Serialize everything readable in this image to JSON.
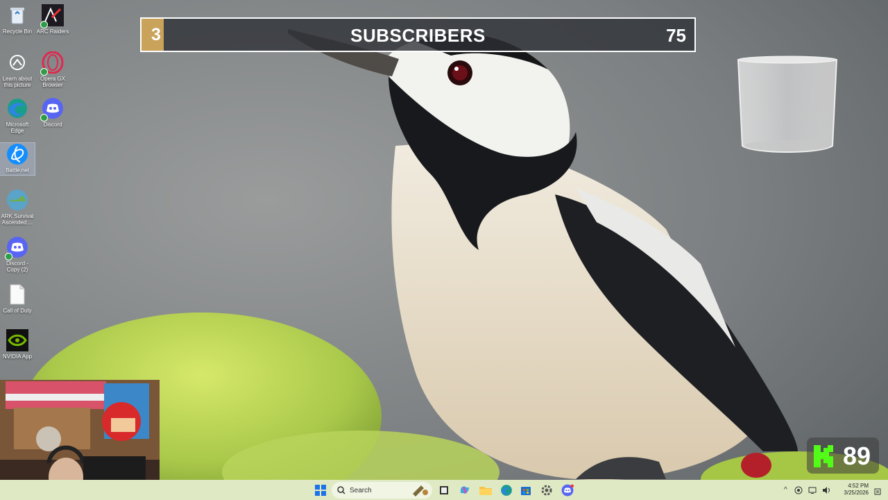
{
  "desktop": {
    "icons": [
      {
        "label": "Recycle Bin",
        "icon": "recycle-bin-icon"
      },
      {
        "label": "ARC Raiders",
        "icon": "arc-raiders-icon"
      },
      {
        "label": "Learn about this picture",
        "icon": "learn-about-picture-icon"
      },
      {
        "label": "Opera GX Browser",
        "icon": "opera-gx-icon"
      },
      {
        "label": "Microsoft Edge",
        "icon": "edge-icon"
      },
      {
        "label": "Discord",
        "icon": "discord-icon"
      },
      {
        "label": "Battle.net",
        "icon": "battlenet-icon"
      },
      {
        "label": "ARK Survival Ascended ...",
        "icon": "ark-icon"
      },
      {
        "label": "Discord - Copy (2)",
        "icon": "discord-icon"
      },
      {
        "label": "Call of Duty",
        "icon": "file-icon"
      },
      {
        "label": "NVIDIA App",
        "icon": "nvidia-icon"
      }
    ]
  },
  "subscriber_goal": {
    "count": "3",
    "label": "SUBSCRIBERS",
    "goal": "75",
    "progress_fraction": 0.04,
    "fill_color": "#c9a35a"
  },
  "kick": {
    "count": "89",
    "brand_color": "#53fc18"
  },
  "taskbar": {
    "search_label": "Search",
    "items": [
      "start-icon",
      "search-icon",
      "pen-icon",
      "task-view-icon",
      "copilot-icon",
      "file-explorer-icon",
      "edge-icon",
      "store-icon",
      "settings-icon",
      "discord-icon"
    ],
    "time": "4:52 PM",
    "date": "3/25/2026"
  }
}
